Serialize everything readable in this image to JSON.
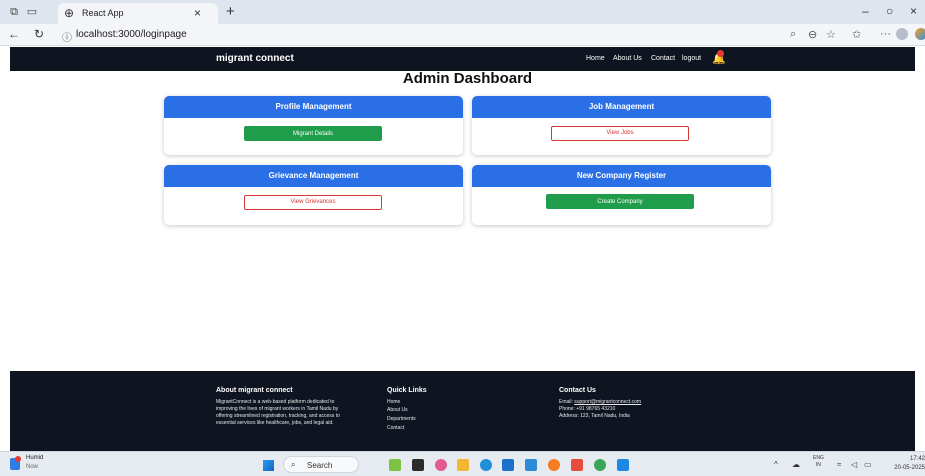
{
  "browser": {
    "tab_title": "React App",
    "url_display": "localhost:3000/loginpage"
  },
  "navbar": {
    "brand": "migrant connect",
    "links": [
      "Home",
      "About Us",
      "Contact",
      "logout"
    ]
  },
  "page": {
    "title": "Admin Dashboard"
  },
  "cards": [
    {
      "title": "Profile Management",
      "button": "Migrant Details"
    },
    {
      "title": "Job Management",
      "button": "View Jobs"
    },
    {
      "title": "Grievance Management",
      "button": "View Grievances"
    },
    {
      "title": "New Company Register",
      "button": "Create Company"
    }
  ],
  "footer": {
    "about_title": "About migrant connect",
    "about_lines": [
      "MigrantConnect is a web-based platform dedicated to",
      "improving the lives of migrant workers in Tamil Nadu by",
      "offering streamlined registration, tracking, and access to",
      "essential services like healthcare, jobs, and legal aid."
    ],
    "links_title": "Quick Links",
    "links": [
      "Home",
      "About Us",
      "Departments",
      "Contact"
    ],
    "contact_title": "Contact Us",
    "email_label": "Email: ",
    "email": "support@migrantconnect.com",
    "phone": "Phone: +91 98765 43210",
    "address": "Address: 123, Tamil Nadu, India"
  },
  "taskbar": {
    "weather_label": "Humid",
    "weather_sub": "Now",
    "search_placeholder": "Search",
    "lang_top": "ENG",
    "lang_bottom": "IN",
    "time": "17:42",
    "date": "20-05-2025"
  },
  "colors": {
    "navbar_bg": "#0f1520",
    "card_header": "#2a6fe6",
    "button_green": "#1f9d4a",
    "button_outline": "#d93636"
  }
}
